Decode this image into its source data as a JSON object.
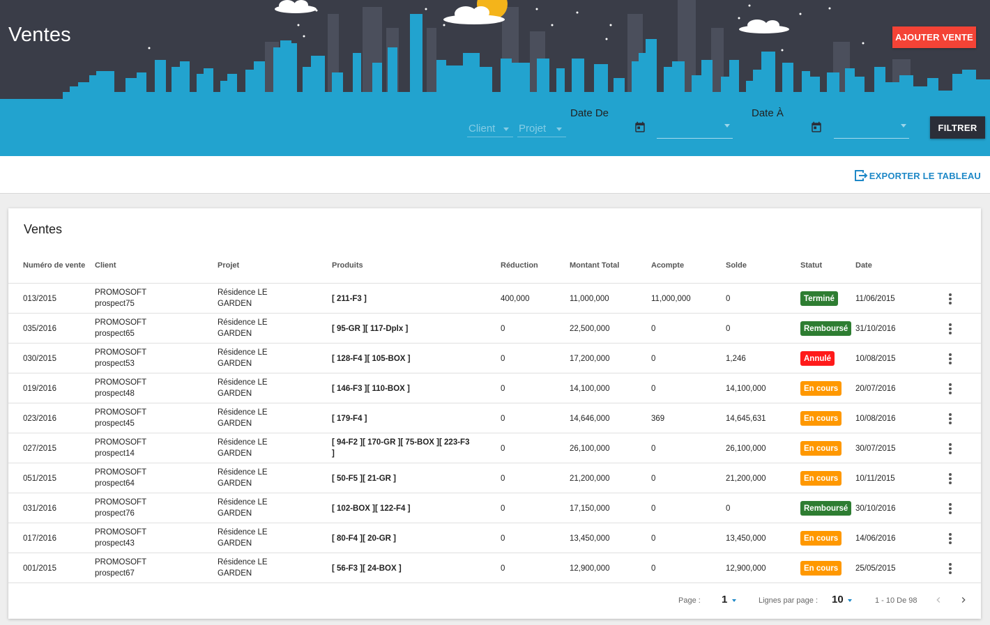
{
  "header": {
    "title": "Ventes",
    "add_button": "AJOUTER VENTE",
    "filter_button": "FILTRER",
    "client_placeholder": "Client",
    "projet_placeholder": "Projet",
    "date_de_label": "Date De",
    "date_a_label": "Date À"
  },
  "toolbar": {
    "export_label": "EXPORTER LE TABLEAU"
  },
  "table": {
    "title": "Ventes",
    "columns": [
      "Numéro de vente",
      "Client",
      "Projet",
      "Produits",
      "Réduction",
      "Montant Total",
      "Acompte",
      "Solde",
      "Statut",
      "Date"
    ],
    "rows": [
      {
        "num": "013/2015",
        "client1": "PROMOSOFT",
        "client2": "prospect75",
        "proj1": "Résidence LE",
        "proj2": "GARDEN",
        "prod1": "[ 211-F3 ]",
        "prod2": "",
        "reduction": "400,000",
        "total": "11,000,000",
        "acompte": "11,000,000",
        "solde": "0",
        "statut": "Terminé",
        "date": "11/06/2015"
      },
      {
        "num": "035/2016",
        "client1": "PROMOSOFT",
        "client2": "prospect65",
        "proj1": "Résidence LE",
        "proj2": "GARDEN",
        "prod1": "[ 95-GR ][ 117-Dplx ]",
        "prod2": "",
        "reduction": "0",
        "total": "22,500,000",
        "acompte": "0",
        "solde": "0",
        "statut": "Remboursé",
        "date": "31/10/2016"
      },
      {
        "num": "030/2015",
        "client1": "PROMOSOFT",
        "client2": "prospect53",
        "proj1": "Résidence LE",
        "proj2": "GARDEN",
        "prod1": "[ 128-F4 ][ 105-BOX ]",
        "prod2": "",
        "reduction": "0",
        "total": "17,200,000",
        "acompte": "0",
        "solde": "1,246",
        "statut": "Annulé",
        "date": "10/08/2015"
      },
      {
        "num": "019/2016",
        "client1": "PROMOSOFT",
        "client2": "prospect48",
        "proj1": "Résidence LE",
        "proj2": "GARDEN",
        "prod1": "[ 146-F3 ][ 110-BOX ]",
        "prod2": "",
        "reduction": "0",
        "total": "14,100,000",
        "acompte": "0",
        "solde": "14,100,000",
        "statut": "En cours",
        "date": "20/07/2016"
      },
      {
        "num": "023/2016",
        "client1": "PROMOSOFT",
        "client2": "prospect45",
        "proj1": "Résidence LE",
        "proj2": "GARDEN",
        "prod1": "[ 179-F4 ]",
        "prod2": "",
        "reduction": "0",
        "total": "14,646,000",
        "acompte": "369",
        "solde": "14,645,631",
        "statut": "En cours",
        "date": "10/08/2016"
      },
      {
        "num": "027/2015",
        "client1": "PROMOSOFT",
        "client2": "prospect14",
        "proj1": "Résidence LE",
        "proj2": "GARDEN",
        "prod1": "[ 94-F2 ][ 170-GR ][ 75-BOX ][ 223-F3",
        "prod2": "]",
        "reduction": "0",
        "total": "26,100,000",
        "acompte": "0",
        "solde": "26,100,000",
        "statut": "En cours",
        "date": "30/07/2015"
      },
      {
        "num": "051/2015",
        "client1": "PROMOSOFT",
        "client2": "prospect64",
        "proj1": "Résidence LE",
        "proj2": "GARDEN",
        "prod1": "[ 50-F5 ][ 21-GR ]",
        "prod2": "",
        "reduction": "0",
        "total": "21,200,000",
        "acompte": "0",
        "solde": "21,200,000",
        "statut": "En cours",
        "date": "10/11/2015"
      },
      {
        "num": "031/2016",
        "client1": "PROMOSOFT",
        "client2": "prospect76",
        "proj1": "Résidence LE",
        "proj2": "GARDEN",
        "prod1": "[ 102-BOX ][ 122-F4 ]",
        "prod2": "",
        "reduction": "0",
        "total": "17,150,000",
        "acompte": "0",
        "solde": "0",
        "statut": "Remboursé",
        "date": "30/10/2016"
      },
      {
        "num": "017/2016",
        "client1": "PROMOSOFT",
        "client2": "prospect43",
        "proj1": "Résidence LE",
        "proj2": "GARDEN",
        "prod1": "[ 80-F4 ][ 20-GR ]",
        "prod2": "",
        "reduction": "0",
        "total": "13,450,000",
        "acompte": "0",
        "solde": "13,450,000",
        "statut": "En cours",
        "date": "14/06/2016"
      },
      {
        "num": "001/2015",
        "client1": "PROMOSOFT",
        "client2": "prospect67",
        "proj1": "Résidence LE",
        "proj2": "GARDEN",
        "prod1": "[ 56-F3 ][ 24-BOX ]",
        "prod2": "",
        "reduction": "0",
        "total": "12,900,000",
        "acompte": "0",
        "solde": "12,900,000",
        "statut": "En cours",
        "date": "25/05/2015"
      }
    ]
  },
  "status_colors": {
    "Terminé": "#2e7d32",
    "Remboursé": "#2e7d32",
    "Annulé": "#ff1a1a",
    "En cours": "#ff9800"
  },
  "pagination": {
    "page_label": "Page :",
    "page_value": "1",
    "rows_label": "Lignes par page :",
    "rows_value": "10",
    "range": "1 - 10 De 98"
  },
  "colors": {
    "accent": "#1e88c7",
    "sky": "#3a3d48",
    "city": "#22a3cf",
    "danger": "#f44336"
  }
}
